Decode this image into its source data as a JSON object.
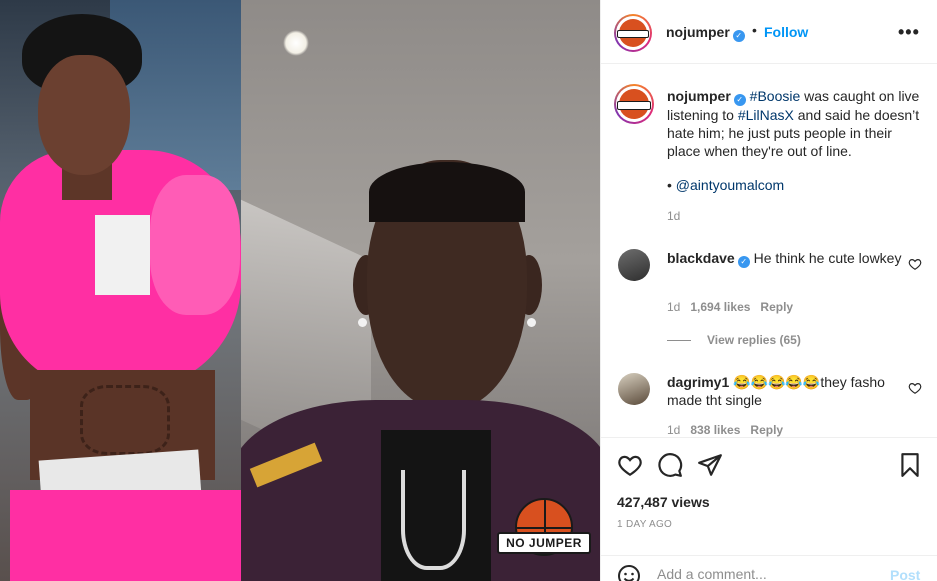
{
  "header": {
    "username": "nojumper",
    "separator": "•",
    "follow_label": "Follow",
    "more_icon": "more-horizontal-icon",
    "more_label": "•••"
  },
  "media": {
    "watermark_text": "NO JUMPER"
  },
  "caption": {
    "username": "nojumper",
    "text_parts": [
      "#Boosie",
      " was caught on live listening to ",
      "#LilNasX",
      " and said he doesn’t hate him; he just puts people in their place when they're out of line."
    ],
    "mention_prefix": "• ",
    "mention": "@aintyoumalcom",
    "time": "1d"
  },
  "comments": [
    {
      "username": "blackdave",
      "verified": true,
      "text": "He think he cute lowkey",
      "time": "1d",
      "likes": "1,694 likes",
      "reply_label": "Reply"
    },
    {
      "username": "dagrimy1",
      "verified": false,
      "emoji": "😂😂😂😂😂",
      "text": "they fasho made tht single",
      "time": "1d",
      "likes": "838 likes",
      "reply_label": "Reply"
    }
  ],
  "view_replies": "View replies (65)",
  "actions": {
    "like_icon": "heart-icon",
    "comment_icon": "comment-icon",
    "share_icon": "share-icon",
    "save_icon": "bookmark-icon"
  },
  "stats": {
    "views": "427,487 views",
    "posted": "1 DAY AGO"
  },
  "add_comment": {
    "placeholder": "Add a comment...",
    "post_label": "Post"
  },
  "colors": {
    "link": "#00376b",
    "follow": "#0095f6",
    "muted": "#8e8e8e",
    "verified": "#3897f0"
  }
}
